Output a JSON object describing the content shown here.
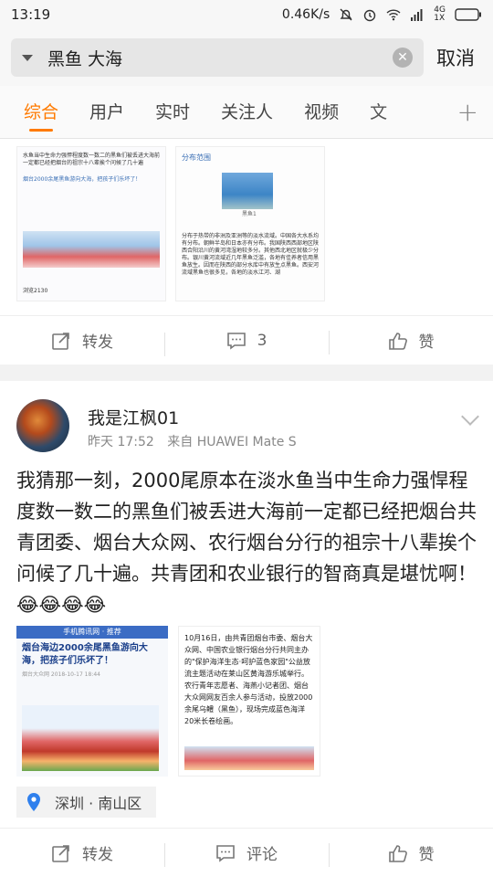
{
  "status_bar": {
    "time": "13:19",
    "network_speed": "0.46K/s",
    "signal_label": "4G",
    "signal_sub": "1X"
  },
  "search": {
    "query": "黑鱼 大海",
    "cancel_label": "取消"
  },
  "tabs": [
    {
      "label": "综合",
      "active": true
    },
    {
      "label": "用户",
      "active": false
    },
    {
      "label": "实时",
      "active": false
    },
    {
      "label": "关注人",
      "active": false
    },
    {
      "label": "视频",
      "active": false
    },
    {
      "label": "文",
      "active": false
    }
  ],
  "card1": {
    "thumb1_text": "水鱼当中生命力强悍程度数一数二的黑鱼们被丢进大海前一定都已经把烟台的祖宗十八辈挨个问候了几十遍",
    "thumb1_caption": "烟台2000余尾黑鱼游向大海，把孩子们乐坏了！",
    "thumb1_views": "浏览2130",
    "thumb2_header": "分布范围",
    "thumb2_text": "分布于热带的非洲及亚洲等的淡水流域。中国各大水系均有分布。朝鲜半岛和日本亦有分布。我国陕西西部地区陕西合阳沿川的黄河湾湿地较多分。其他西北地区就极少分布。银川黄河流域近几年黑鱼泛滥，各地有佳养者信用黑鱼放生。因而在陕西的部分水库中有放生点黑鱼。西安河流域黑鱼也很多见，各地的淡水江河、湖",
    "thumb2_fig": "黑鱼1",
    "actions": {
      "repost": "转发",
      "comment": "3",
      "like": "赞"
    }
  },
  "card2": {
    "username": "我是江枫01",
    "time": "昨天 17:52",
    "source": "来自 HUAWEI Mate S",
    "text": "我猜那一刻，2000尾原本在淡水鱼当中生命力强悍程度数一数二的黑鱼们被丢进大海前一定都已经把烟台共青团委、烟台大众网、农行烟台分行的祖宗十八辈挨个问候了几十遍。共青团和农业银行的智商真是堪忧啊！😂😂😂😂",
    "image1": {
      "header": "手机腾讯网 · 推荐",
      "title": "烟台海边2000余尾黑鱼游向大海，把孩子们乐坏了！",
      "sub": "烟台大众网  2018-10-17 18:44"
    },
    "image2": {
      "text": "10月16日，由共青团烟台市委、烟台大众网、中国农业银行烟台分行共同主办的\"保护海洋生态·呵护蓝色家园\"公益放流主题活动在莱山区黄海游乐城举行。农行青年志愿者、海燕小记者团、烟台大众网网友百余人参与活动，投放2000余尾乌鳢（黑鱼），现场完成蓝色海洋20米长卷绘画。"
    },
    "location": "深圳 · 南山区",
    "actions": {
      "repost": "转发",
      "comment": "评论",
      "like": "赞"
    }
  },
  "colors": {
    "accent": "#ff7a00",
    "location_pin": "#2f80ed"
  }
}
